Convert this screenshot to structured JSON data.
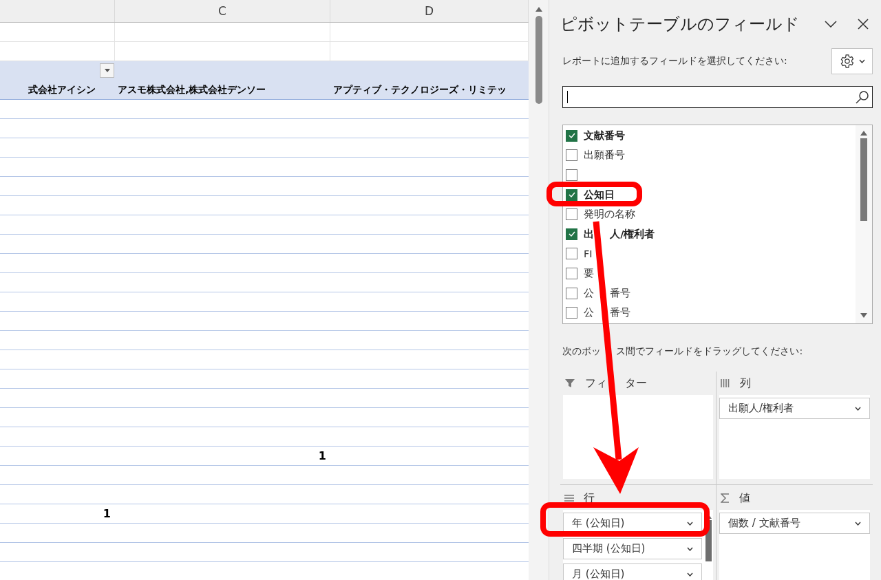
{
  "spreadsheet": {
    "column_headers": [
      "C",
      "D"
    ],
    "pivot_headers": [
      "式会社アイシン",
      "アスモ株式会社,株式会社デンソー",
      "アプティブ・テクノロジーズ・リミテッ"
    ],
    "rows": [
      {},
      {},
      {},
      {},
      {},
      {},
      {},
      {},
      {},
      {},
      {},
      {},
      {},
      {},
      {},
      {},
      {},
      {},
      {
        "column_2": "1"
      },
      {},
      {},
      {
        "column_1": "1"
      },
      {},
      {},
      {}
    ]
  },
  "pane": {
    "title": "ピボットテーブルのフィールド",
    "report_prompt": "レポートに追加するフィールドを選択してください:",
    "fields": [
      {
        "label": "文献番号",
        "checked": true
      },
      {
        "label": "出願番号",
        "checked": false
      },
      {
        "checked": false
      },
      {
        "label": "公知日",
        "checked": true
      },
      {
        "label": "発明の名称",
        "checked": false
      },
      {
        "label_parts": [
          "出",
          "人/権利者"
        ],
        "checked": true
      },
      {
        "label": "FI",
        "checked": false
      },
      {
        "label": "要",
        "checked": false
      },
      {
        "label_parts": [
          "公",
          "番号"
        ],
        "checked": false
      },
      {
        "label_parts": [
          "公",
          "番号"
        ],
        "checked": false
      }
    ],
    "drag_prompt_parts": [
      "次のボッ",
      "ス間でフィールドをドラッグしてください:"
    ],
    "areas": [
      {
        "kind": "filter",
        "label_parts": [
          "フィ",
          "ター"
        ]
      },
      {
        "kind": "columns",
        "label": "列",
        "items": [
          "出願人/権利者"
        ]
      },
      {
        "kind": "rows",
        "label": "行",
        "items": [
          "年 (公知日)",
          "四半期 (公知日)",
          "月 (公知日)"
        ]
      },
      {
        "kind": "values",
        "label": "値",
        "items": [
          "個数 / 文献番号"
        ]
      }
    ]
  }
}
